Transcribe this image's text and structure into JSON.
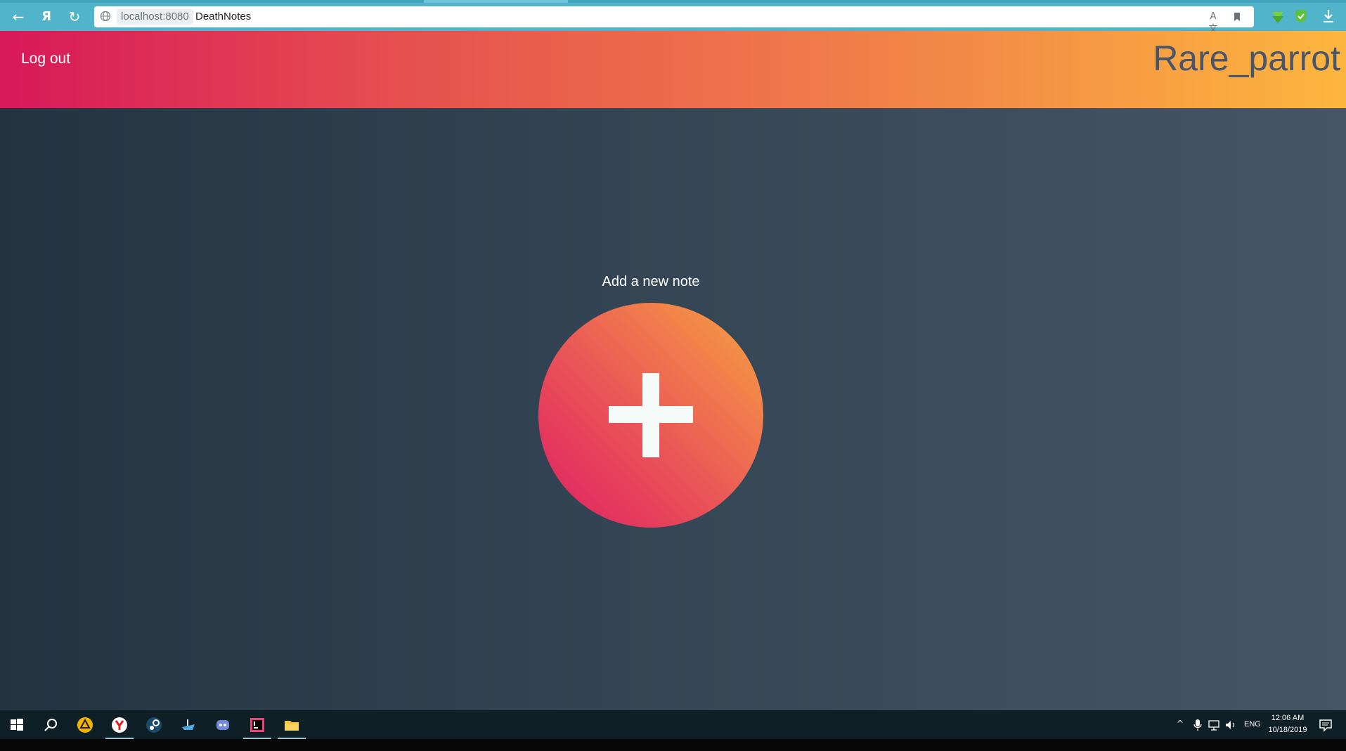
{
  "browser": {
    "address_host": "localhost:8080",
    "tab_title": "DeathNotes",
    "icons": [
      "back-arrow-icon",
      "yandex-logo-icon",
      "reload-icon",
      "globe-icon",
      "translate-icon",
      "bookmark-icon",
      "download-extension-icon",
      "shield-check-icon",
      "download-icon"
    ]
  },
  "header": {
    "logout_label": "Log out",
    "username": "Rare_parrot",
    "gradient_start": "#d8185a",
    "gradient_end": "#fcb63e"
  },
  "main": {
    "add_note_label": "Add a new note",
    "add_button_icon": "plus-icon",
    "background": "#2f4150"
  },
  "taskbar": {
    "apps": [
      "windows-start-icon",
      "search-icon",
      "app-triangle-icon",
      "yandex-browser-icon",
      "steam-icon",
      "ship-app-icon",
      "discord-icon",
      "intellij-icon",
      "file-explorer-icon"
    ],
    "language": "ENG",
    "time": "12:06 AM",
    "date": "10/18/2019"
  }
}
